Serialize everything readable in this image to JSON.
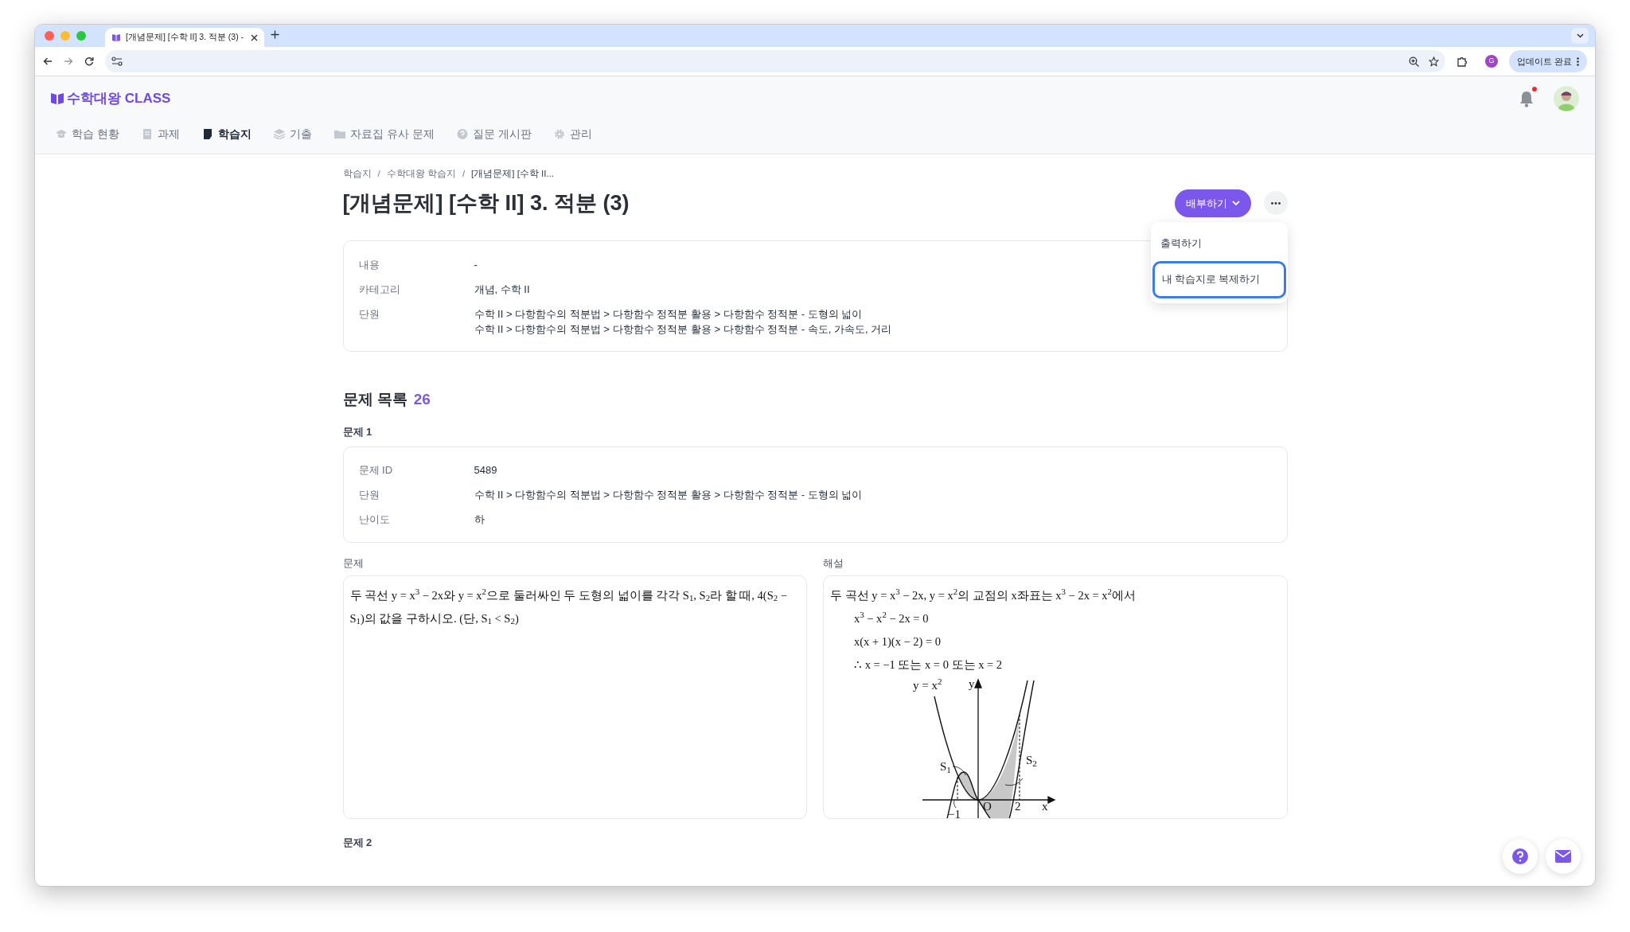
{
  "browser": {
    "tab_title": "[개념문제] [수학 II] 3. 적분 (3) -",
    "profile_initial": "G",
    "update_button": "업데이트 완료"
  },
  "app": {
    "logo": "수학대왕 CLASS",
    "has_notification": true,
    "nav": [
      {
        "label": "학습 현황",
        "selected": false
      },
      {
        "label": "과제",
        "selected": false
      },
      {
        "label": "학습지",
        "selected": true
      },
      {
        "label": "기출",
        "selected": false
      },
      {
        "label": "자료집 유사 문제",
        "selected": false
      },
      {
        "label": "질문 게시판",
        "selected": false
      },
      {
        "label": "관리",
        "selected": false
      }
    ]
  },
  "page": {
    "breadcrumb": [
      "학습지",
      "수학대왕 학습지",
      "[개념문제] [수학 II..."
    ],
    "breadcrumb_separator": "/",
    "title": "[개념문제] [수학 II] 3. 적분 (3)",
    "distribute_button": "배부하기",
    "more_menu": {
      "open": true,
      "items": [
        {
          "label": "출력하기",
          "focused": false
        },
        {
          "label": "내 학습지로 복제하기",
          "focused": true
        }
      ]
    },
    "info": [
      {
        "label": "내용",
        "values": [
          "-"
        ]
      },
      {
        "label": "카테고리",
        "values": [
          "개념, 수학 II"
        ]
      },
      {
        "label": "단원",
        "values": [
          "수학 II > 다항함수의 적분법 > 다항함수 정적분 활용 > 다항함수 정적분 - 도형의 넓이",
          "수학 II > 다항함수의 적분법 > 다항함수 정적분 활용 > 다항함수 정적분 - 속도, 가속도, 거리"
        ]
      }
    ]
  },
  "problem_list": {
    "title": "문제 목록",
    "count": "26",
    "problems": [
      {
        "heading": "문제 1",
        "meta": [
          {
            "label": "문제 ID",
            "value": "5489"
          },
          {
            "label": "단원",
            "value": "수학 II > 다항함수의 적분법 > 다항함수 정적분 활용 > 다항함수 정적분 - 도형의 넓이"
          },
          {
            "label": "난이도",
            "value": "하"
          }
        ],
        "question_label": "문제",
        "question_text": "두 곡선 y = x$^{3}$ − 2x와 y = x$^{2}$으로 둘러싸인 두 도형의 넓이를 각각 S$_{1}$, S$_{2}$라 할 때, 4(S$_{2}$ − S$_{1}$)의 값을 구하시오. (단, S$_{1}$ < S$_{2}$)",
        "solution_label": "해설",
        "solution_lines": [
          {
            "text": "두 곡선 y = x$^{3}$ − 2x, y = x$^{2}$의 교점의 x좌표는 x$^{3}$ − 2x = x$^{2}$에서",
            "indented": false
          },
          {
            "text": "x$^{3}$ − x$^{2}$ − 2x = 0",
            "indented": true
          },
          {
            "text": "x(x + 1)(x − 2) = 0",
            "indented": true
          },
          {
            "text": "∴ x = −1 또는 x = 0 또는 x = 2",
            "indented": true
          }
        ],
        "figure_labels": [
          "y = x$^{2}$",
          "y",
          "S$_{1}$",
          "S$_{2}$",
          "O",
          "2",
          "x",
          "−1"
        ]
      },
      {
        "heading": "문제 2"
      }
    ]
  }
}
